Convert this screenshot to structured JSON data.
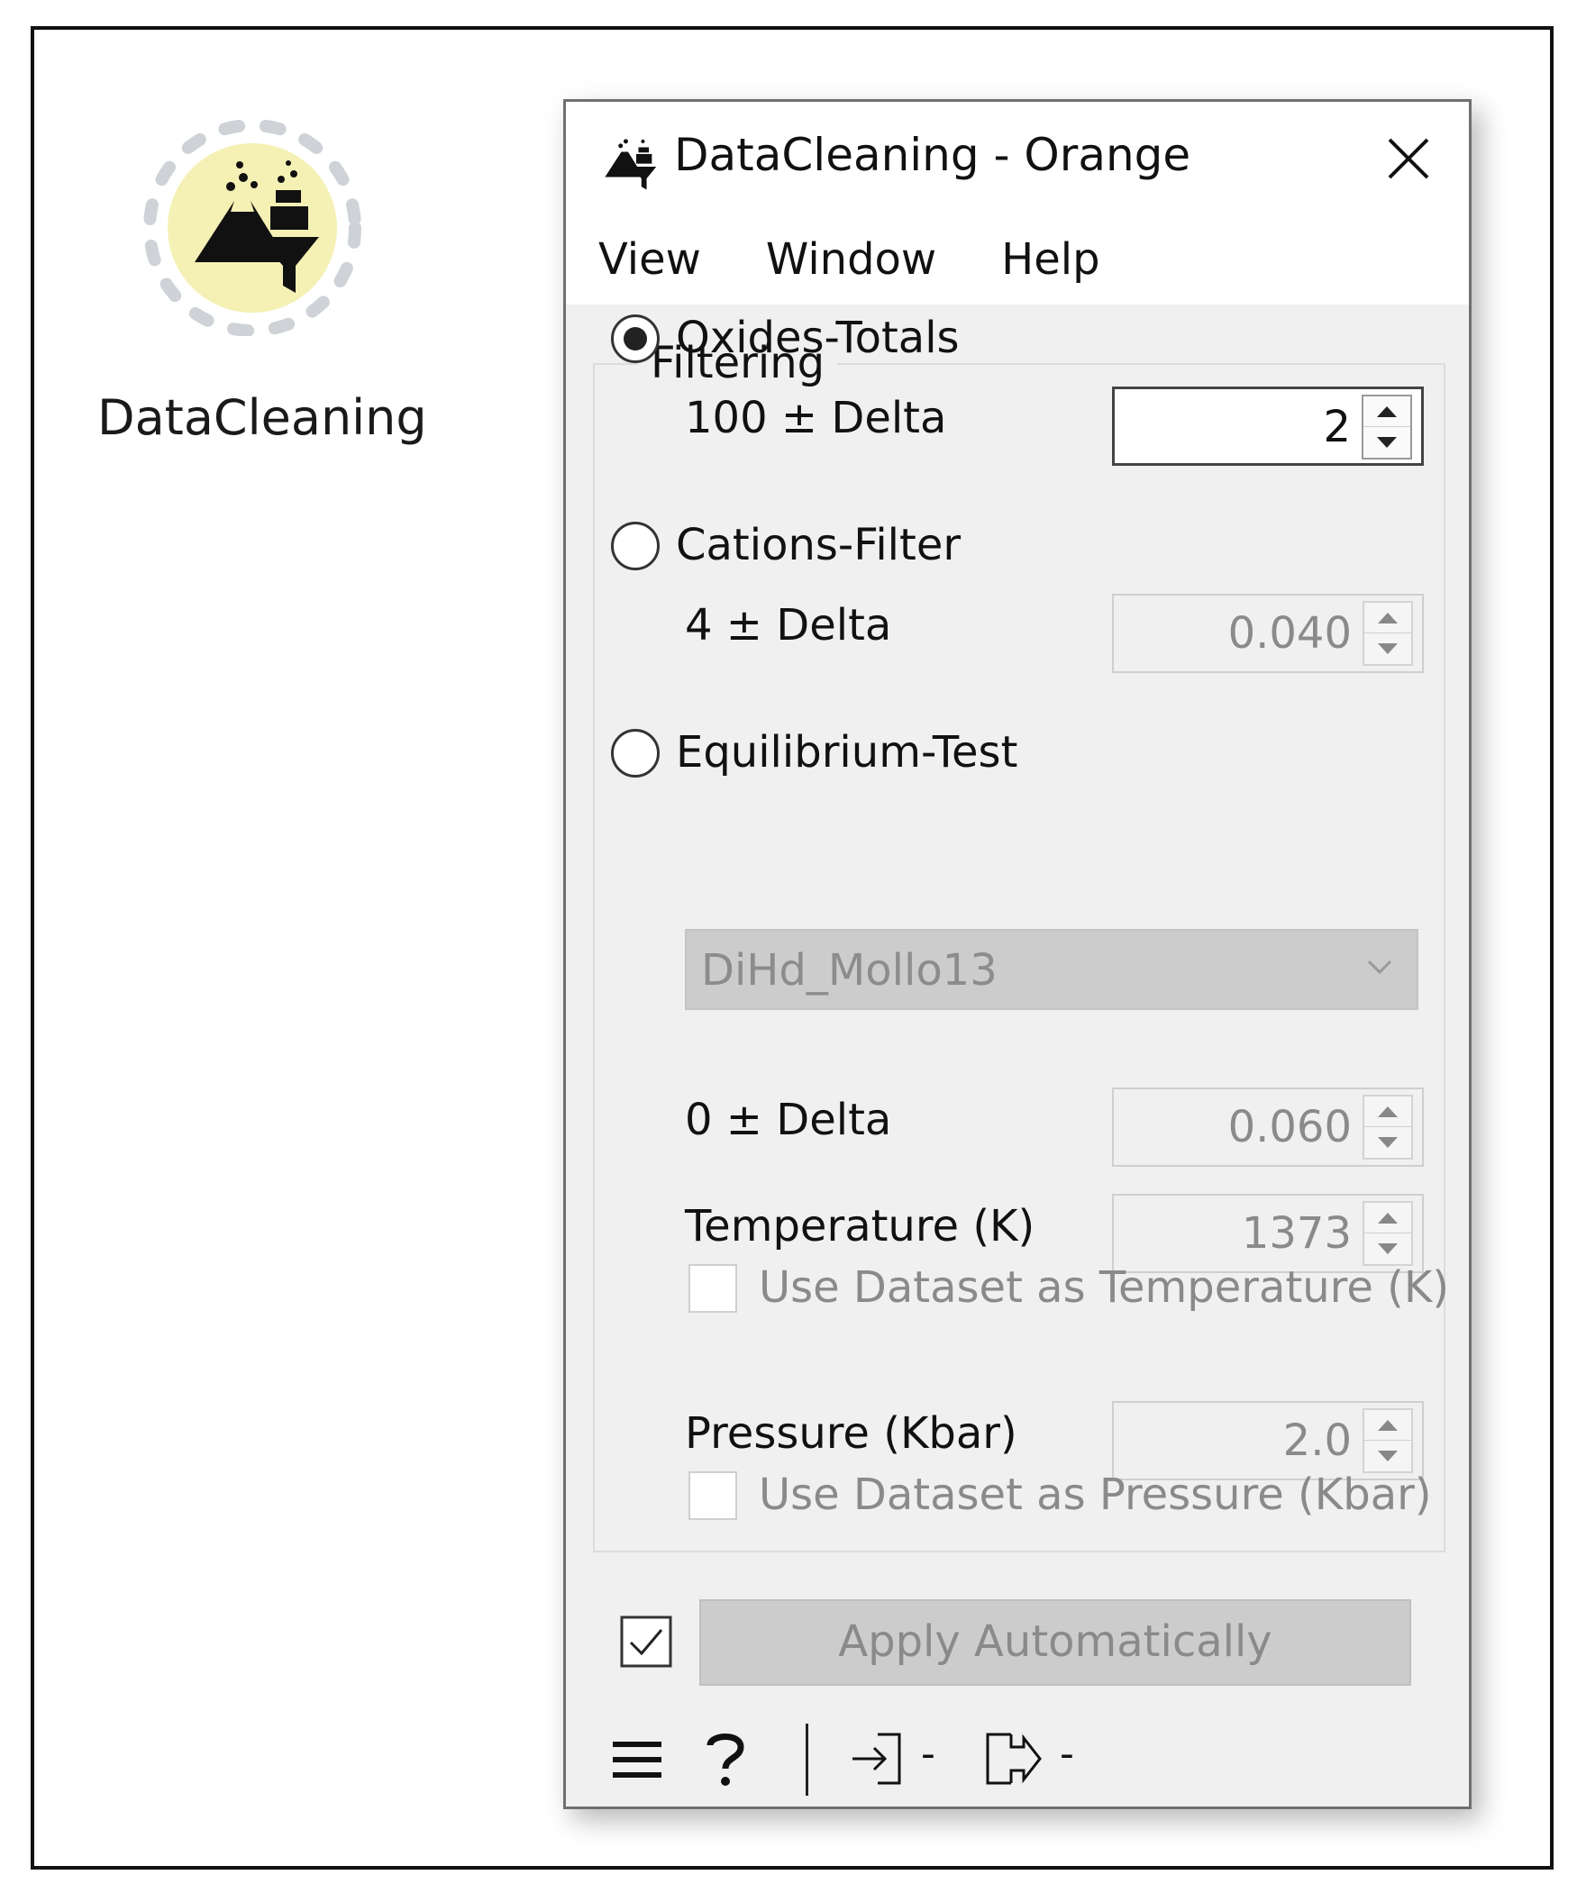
{
  "canvas": {
    "node_label": "DataCleaning",
    "node_icon": "volcano-funnel-icon",
    "node_color": "#f5f1b5"
  },
  "window": {
    "title": "DataCleaning - Orange",
    "app_icon": "volcano-funnel-icon",
    "close_icon": "close-icon",
    "menu": [
      "View",
      "Window",
      "Help"
    ]
  },
  "filtering": {
    "group_title": "Filtering",
    "oxides": {
      "label": "Oxides-Totals",
      "checked": true,
      "delta_label": "100 ± Delta",
      "delta_value": "2"
    },
    "cations": {
      "label": "Cations-Filter",
      "checked": false,
      "delta_label": "4 ± Delta",
      "delta_value": "0.040"
    },
    "equilibrium": {
      "label": "Equilibrium-Test",
      "checked": false,
      "model": "DiHd_Mollo13",
      "delta_label": "0 ± Delta",
      "delta_value": "0.060",
      "temperature_label": "Temperature (K)",
      "temperature_value": "1373",
      "use_dataset_temperature": "Use Dataset as Temperature (K)",
      "pressure_label": "Pressure (Kbar)",
      "pressure_value": "2.0",
      "use_dataset_pressure": "Use Dataset as Pressure (Kbar)"
    }
  },
  "footer": {
    "auto_apply_checked": true,
    "apply_label": "Apply Automatically"
  },
  "statusbar": {
    "menu_icon": "hamburger-menu-icon",
    "help_icon": "help-question-icon",
    "input_icon": "input-arrow-icon",
    "input_text": "-",
    "output_icon": "output-arrow-icon",
    "output_text": "-"
  }
}
